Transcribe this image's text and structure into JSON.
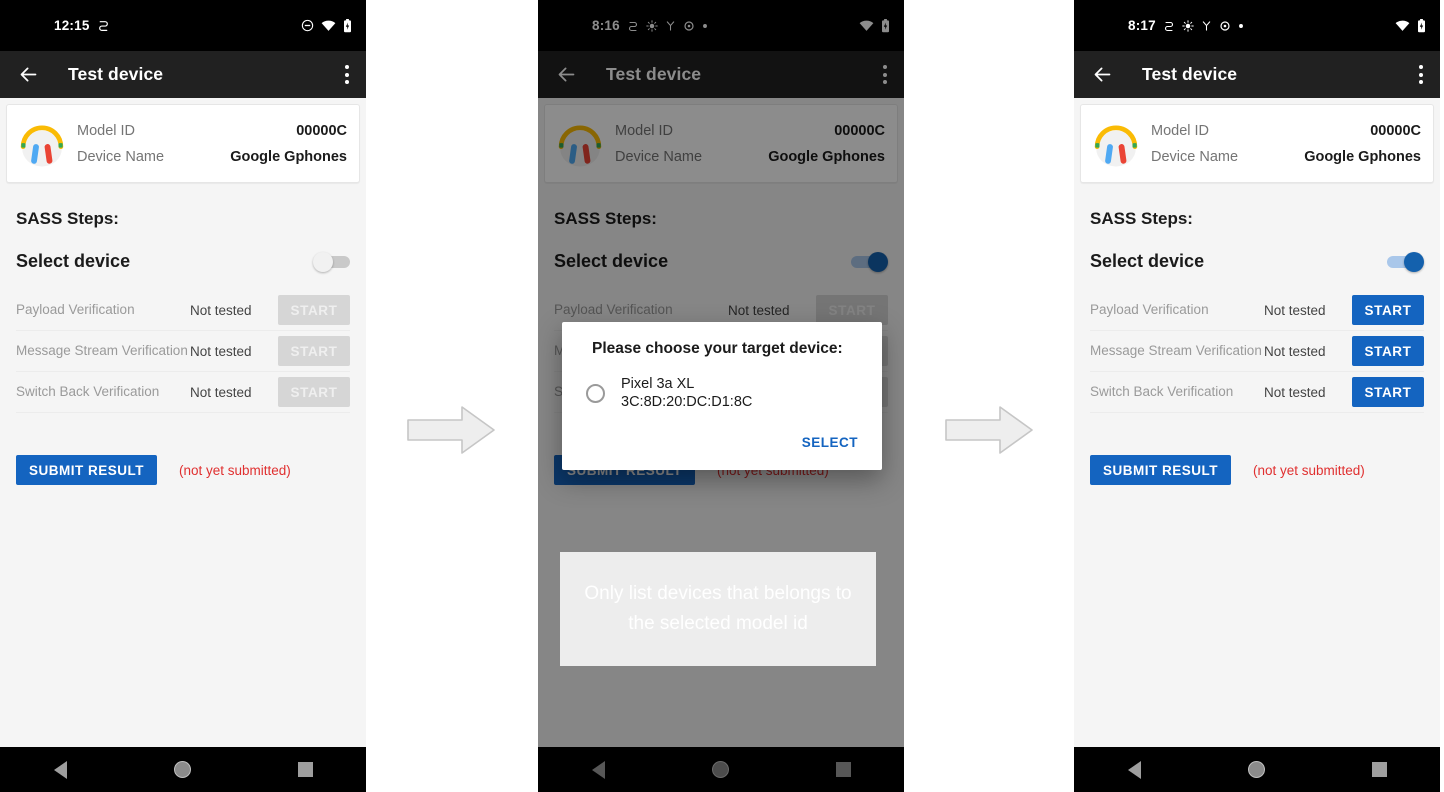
{
  "meta": {
    "app_title": "Test device",
    "accent_blue": "#1464c0",
    "warn_red": "#e03030"
  },
  "icons": {
    "back": "back-arrow-icon",
    "overflow": "overflow-menu-icon",
    "device": "headphones-icon",
    "nav_back": "nav-back-icon",
    "nav_home": "nav-home-icon",
    "nav_recents": "nav-recents-icon",
    "wifi": "wifi-icon",
    "battery": "battery-icon",
    "dnd": "do-not-disturb-icon",
    "sync": "sync-icon",
    "brightness": "brightness-icon",
    "bluetooth_alt": "location-icon",
    "settings": "settings-gear-icon",
    "dot": "dot-icon"
  },
  "device_card": {
    "rows": [
      {
        "key": "Model ID",
        "value": "00000C"
      },
      {
        "key": "Device Name",
        "value": "Google Gphones"
      }
    ]
  },
  "sections": {
    "sass_title": "SASS Steps:",
    "select_device_label": "Select device"
  },
  "steps": [
    {
      "name": "Payload Verification",
      "status": "Not tested",
      "action": "START"
    },
    {
      "name": "Message Stream Verification",
      "status": "Not tested",
      "action": "START"
    },
    {
      "name": "Switch Back Verification",
      "status": "Not tested",
      "action": "START"
    }
  ],
  "submit": {
    "label": "SUBMIT RESULT",
    "note": "(not yet submitted)"
  },
  "panels": [
    {
      "id": "panel-1",
      "time": "12:15",
      "status_icons": [
        "sync-icon",
        "do-not-disturb-icon",
        "wifi-icon",
        "battery-icon"
      ],
      "toggle_on": false,
      "start_enabled": false,
      "dimmed": false
    },
    {
      "id": "panel-2",
      "time": "8:16",
      "status_icons": [
        "sync-icon",
        "brightness-icon",
        "location-icon",
        "settings-gear-icon",
        "dot-icon",
        "wifi-icon",
        "battery-icon"
      ],
      "toggle_on": true,
      "start_enabled": false,
      "dimmed": true
    },
    {
      "id": "panel-3",
      "time": "8:17",
      "status_icons": [
        "sync-icon",
        "brightness-icon",
        "location-icon",
        "settings-gear-icon",
        "dot-icon",
        "wifi-icon",
        "battery-icon"
      ],
      "toggle_on": true,
      "start_enabled": true,
      "dimmed": false
    }
  ],
  "dialog": {
    "title": "Please choose your target device:",
    "option_name": "Pixel 3a XL",
    "option_mac": "3C:8D:20:DC:D1:8C",
    "select_label": "SELECT"
  },
  "annotation": {
    "text": "Only list devices that belongs to the selected model id"
  }
}
